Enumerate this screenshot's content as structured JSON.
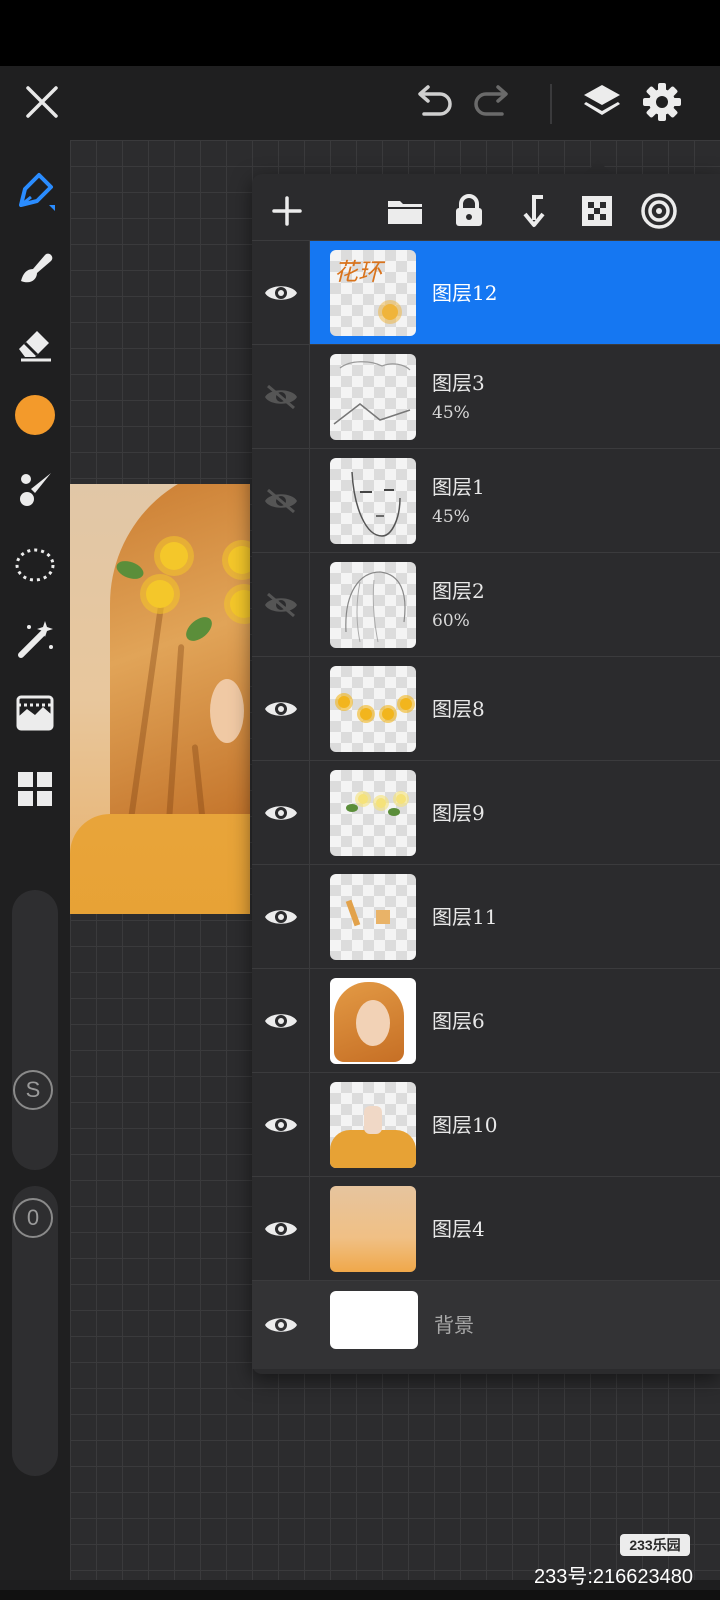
{
  "top_bar": {
    "icons": [
      "close-icon",
      "undo-icon",
      "redo-icon",
      "layers-icon",
      "settings-icon"
    ]
  },
  "left_toolbar": {
    "tools": [
      "pen-tool-icon",
      "smudge-icon",
      "eraser-icon",
      "color-swatch",
      "brush-icon",
      "lasso-selection-icon",
      "magic-wand-icon",
      "adjustment-icon",
      "gallery-icon"
    ],
    "active_color": "#f39a2b",
    "size_slider_label": "S",
    "opacity_slider_label": "0"
  },
  "layers_panel": {
    "toolbar_icons": [
      "add-layer-icon",
      "folder-icon",
      "lock-icon",
      "merge-down-icon",
      "transparency-icon",
      "blend-icon"
    ],
    "layers": [
      {
        "name": "图层12",
        "opacity": "",
        "visible": true,
        "selected": true
      },
      {
        "name": "图层3",
        "opacity": "45%",
        "visible": false,
        "selected": false
      },
      {
        "name": "图层1",
        "opacity": "45%",
        "visible": false,
        "selected": false
      },
      {
        "name": "图层2",
        "opacity": "60%",
        "visible": false,
        "selected": false
      },
      {
        "name": "图层8",
        "opacity": "",
        "visible": true,
        "selected": false
      },
      {
        "name": "图层9",
        "opacity": "",
        "visible": true,
        "selected": false
      },
      {
        "name": "图层11",
        "opacity": "",
        "visible": true,
        "selected": false
      },
      {
        "name": "图层6",
        "opacity": "",
        "visible": true,
        "selected": false
      },
      {
        "name": "图层10",
        "opacity": "",
        "visible": true,
        "selected": false
      },
      {
        "name": "图层4",
        "opacity": "",
        "visible": true,
        "selected": false
      },
      {
        "name": "背景",
        "opacity": "",
        "visible": true,
        "selected": false
      }
    ],
    "selected_color": "#1577f2",
    "thumb_text": "花环"
  },
  "watermark": {
    "logo": "233乐园",
    "id_text": "233号:216623480"
  }
}
